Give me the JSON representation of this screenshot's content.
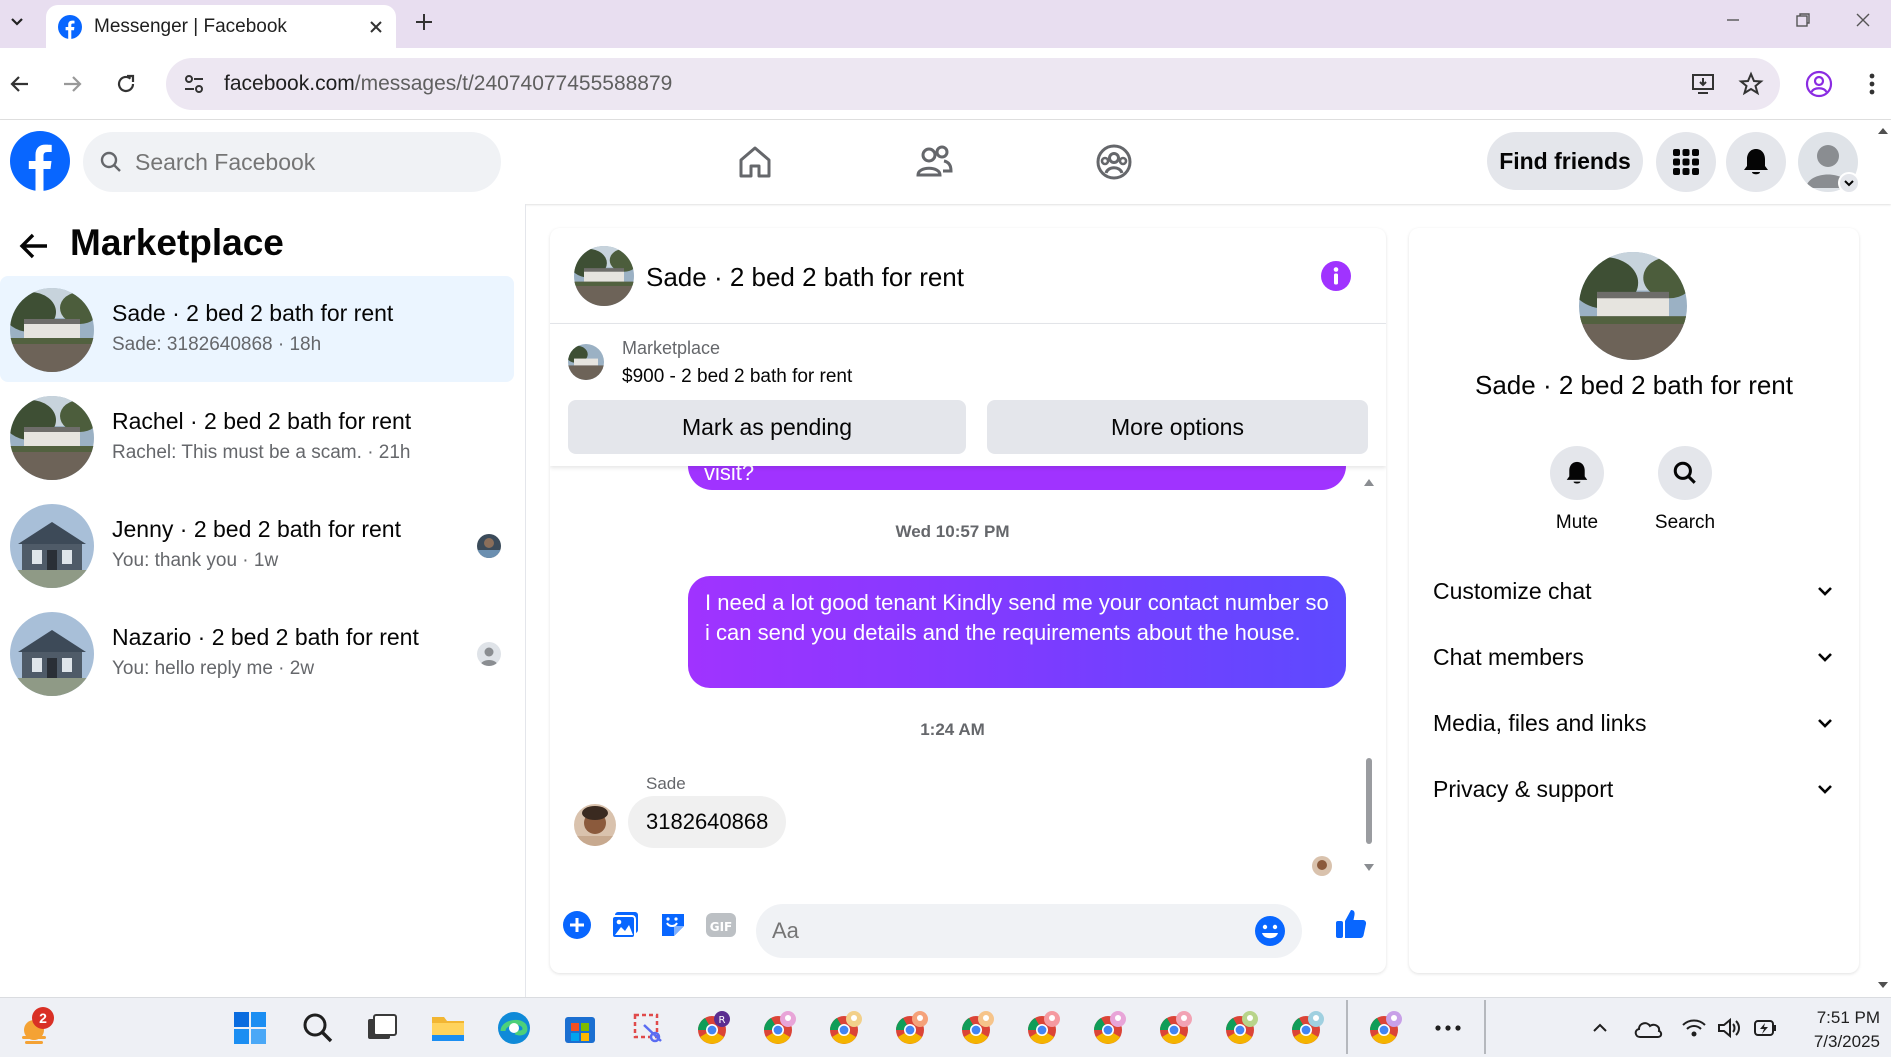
{
  "browser": {
    "tab_title": "Messenger | Facebook",
    "url_domain": "facebook.com",
    "url_path": "/messages/t/24074077455588879"
  },
  "header": {
    "search_placeholder": "Search Facebook",
    "find_friends_label": "Find friends"
  },
  "sidebar": {
    "title": "Marketplace",
    "conversations": [
      {
        "name": "Sade · 2 bed 2 bath for rent",
        "preview": "Sade: 3182640868 · 18h",
        "active": true
      },
      {
        "name": "Rachel · 2 bed 2 bath for rent",
        "preview": "Rachel: This must be a scam. · 21h",
        "active": false
      },
      {
        "name": "Jenny · 2 bed 2 bath for rent",
        "preview": "You: thank you · 1w",
        "active": false
      },
      {
        "name": "Nazario · 2 bed 2 bath for rent",
        "preview": "You: hello reply me · 2w",
        "active": false
      }
    ]
  },
  "chat": {
    "title": "Sade · 2 bed 2 bath for rent",
    "listing": {
      "label": "Marketplace",
      "price_title": "$900 - 2 bed 2 bath for rent",
      "mark_pending_label": "Mark as pending",
      "more_options_label": "More options"
    },
    "previous_message_tail": "visit?",
    "timestamp_1": "Wed 10:57 PM",
    "outgoing_message": "I need a lot good tenant Kindly send me your contact number so i can send you details and the requirements about the house.",
    "timestamp_2": "1:24 AM",
    "incoming_sender": "Sade",
    "incoming_message": "3182640868",
    "composer_placeholder": "Aa"
  },
  "details": {
    "name": "Sade · 2 bed 2 bath for rent",
    "mute_label": "Mute",
    "search_label": "Search",
    "sections": [
      "Customize chat",
      "Chat members",
      "Media, files and links",
      "Privacy & support"
    ]
  },
  "taskbar": {
    "weather_badge": "2",
    "time": "7:51 PM",
    "date": "7/3/2025"
  },
  "colors": {
    "fb_blue": "#0866ff",
    "messenger_purple": "#a033ff",
    "active_conv_bg": "#ebf5ff"
  }
}
